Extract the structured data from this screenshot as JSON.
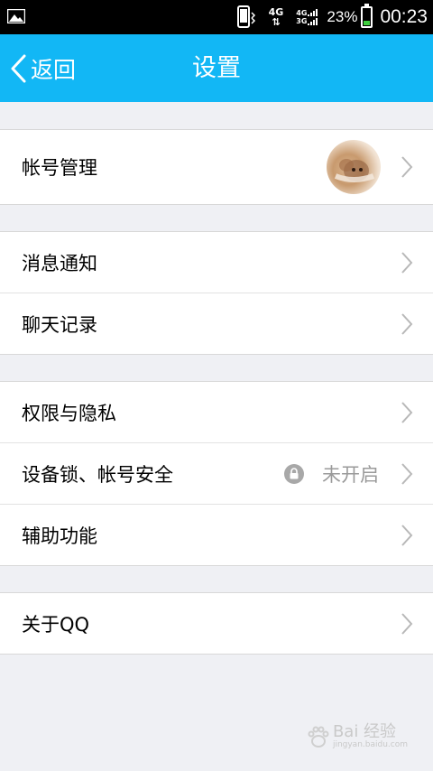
{
  "status_bar": {
    "network": "4G",
    "sig_top": "4G",
    "sig_bottom": "3G",
    "battery_pct": "23%",
    "battery_level": 0.23,
    "time": "00:23"
  },
  "header": {
    "back_label": "返回",
    "title": "设置"
  },
  "groups": {
    "account": {
      "label": "帐号管理"
    },
    "notify": {
      "label": "消息通知"
    },
    "chat_history": {
      "label": "聊天记录"
    },
    "privacy": {
      "label": "权限与隐私"
    },
    "device_lock": {
      "label": "设备锁、帐号安全",
      "status": "未开启"
    },
    "accessibility": {
      "label": "辅助功能"
    },
    "about": {
      "label": "关于QQ"
    }
  },
  "watermark": {
    "text": "Bai 经验",
    "sub": "jingyan.baidu.com"
  },
  "colors": {
    "accent": "#12b7f5",
    "background": "#eff0f4"
  }
}
